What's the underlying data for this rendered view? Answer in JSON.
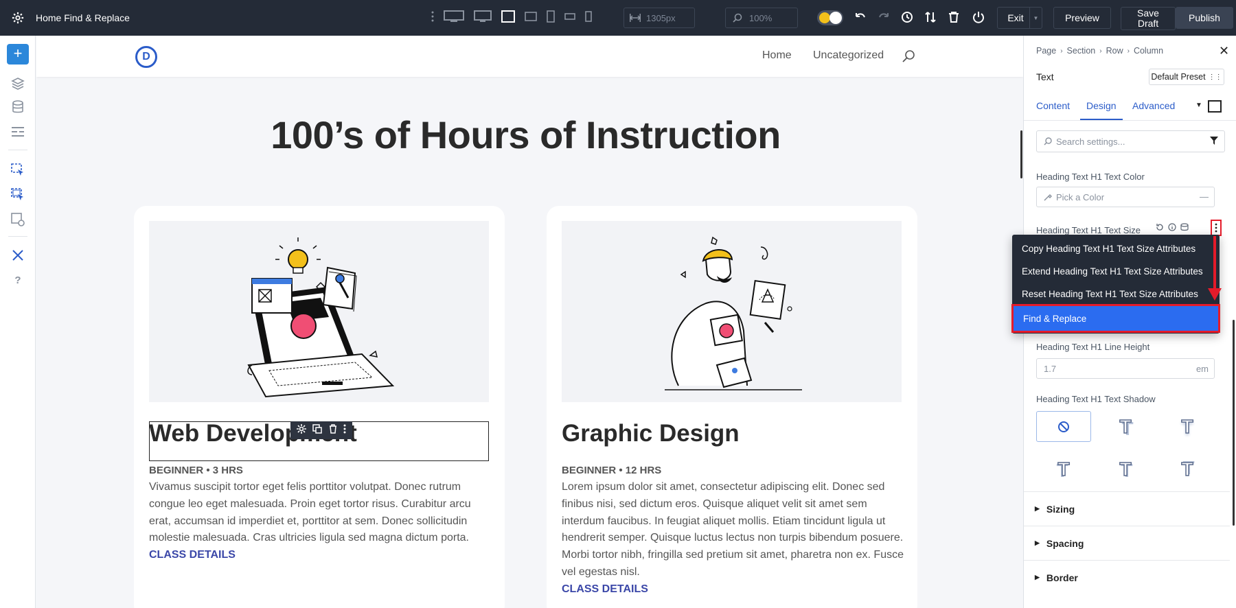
{
  "topbar": {
    "title": "Home Find & Replace",
    "width_value": "1305px",
    "zoom_value": "100%",
    "exit_label": "Exit",
    "preview_label": "Preview",
    "save_draft_label": "Save Draft",
    "publish_label": "Publish"
  },
  "canvas": {
    "nav": {
      "home": "Home",
      "uncategorized": "Uncategorized"
    },
    "logo_letter": "D",
    "headline": "100’s of Hours of Instruction",
    "cards": [
      {
        "title": "Web Development",
        "meta": "BEGINNER • 3 HRS",
        "text": "Vivamus suscipit tortor eget felis porttitor volutpat. Donec rutrum congue leo eget malesuada. Proin eget tortor risus. Curabitur arcu erat, accumsan id imperdiet et, porttitor at sem. Donec sollicitudin molestie malesuada. Cras ultricies ligula sed magna dictum porta.",
        "link": "CLASS DETAILS"
      },
      {
        "title": "Graphic Design",
        "meta": "BEGINNER • 12 HRS",
        "text": "Lorem ipsum dolor sit amet, consectetur adipiscing elit. Donec sed finibus nisi, sed dictum eros. Quisque aliquet velit sit amet sem interdum faucibus. In feugiat aliquet mollis. Etiam tincidunt ligula ut hendrerit semper. Quisque luctus lectus non turpis bibendum posuere. Morbi tortor nibh, fringilla sed pretium sit amet, pharetra non ex. Fusce vel egestas nisl.",
        "link": "CLASS DETAILS"
      }
    ]
  },
  "panel": {
    "breadcrumb": [
      "Page",
      "Section",
      "Row",
      "Column"
    ],
    "module_name": "Text",
    "preset_label": "Default Preset",
    "tabs": [
      "Content",
      "Design",
      "Advanced"
    ],
    "active_tab": "Design",
    "search_placeholder": "Search settings...",
    "fields": {
      "color_label": "Heading Text H1 Text Color",
      "color_placeholder": "Pick a Color",
      "size_label": "Heading Text H1 Text Size",
      "line_height_label": "Heading Text H1 Line Height",
      "line_height_value": "1.7",
      "line_height_unit": "em",
      "shadow_label": "Heading Text H1 Text Shadow"
    },
    "sections": [
      "Sizing",
      "Spacing",
      "Border"
    ]
  },
  "context_menu": {
    "items": [
      "Copy Heading Text H1 Text Size Attributes",
      "Extend Heading Text H1 Text Size Attributes",
      "Reset Heading Text H1 Text Size Attributes",
      "Find & Replace"
    ]
  },
  "colors": {
    "topbar_bg": "#242b37",
    "accent_blue": "#2b87da",
    "menu_highlight": "#2b6cf0",
    "annotation_red": "#e51b2a",
    "link_color": "#3b47a8"
  }
}
